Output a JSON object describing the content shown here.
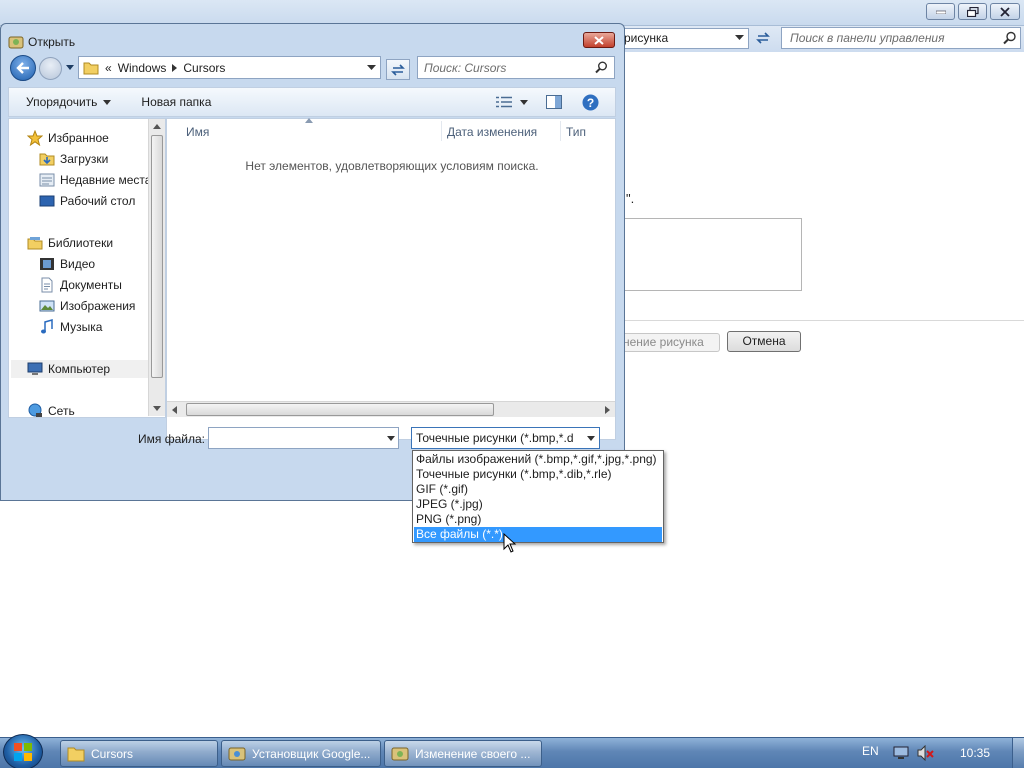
{
  "background_window": {
    "address_text": "рисунка",
    "search_placeholder": "Поиск в панели управления",
    "text_fragment": "\".",
    "change_picture_button": "нение рисунка",
    "cancel_button": "Отмена"
  },
  "dialog": {
    "title": "Открыть",
    "breadcrumb": {
      "prefix": "«",
      "items": [
        "Windows",
        "Cursors"
      ]
    },
    "search_placeholder": "Поиск: Cursors",
    "toolbar": {
      "organize": "Упорядочить",
      "new_folder": "Новая папка"
    },
    "nav": {
      "favorites": "Избранное",
      "downloads": "Загрузки",
      "recent": "Недавние места",
      "desktop": "Рабочий стол",
      "libraries": "Библиотеки",
      "video": "Видео",
      "documents": "Документы",
      "images": "Изображения",
      "music": "Музыка",
      "computer": "Компьютер",
      "network": "Сеть"
    },
    "columns": {
      "name": "Имя",
      "date": "Дата изменения",
      "type": "Тип"
    },
    "empty_message": "Нет элементов, удовлетворяющих условиям поиска.",
    "filename_label": "Имя файла:",
    "filename_value": "",
    "filetype_value": "Точечные рисунки (*.bmp,*.d",
    "filetype_options": [
      "Файлы изображений (*.bmp,*.gif,*.jpg,*.png)",
      "Точечные рисунки (*.bmp,*.dib,*.rle)",
      "GIF (*.gif)",
      "JPEG (*.jpg)",
      "PNG (*.png)",
      "Все файлы (*.*)"
    ],
    "selected_option": "Все файлы (*.*)"
  },
  "taskbar": {
    "items": [
      "Cursors",
      "Установщик Google...",
      "Изменение своего ..."
    ],
    "language": "EN",
    "clock": "10:35"
  }
}
